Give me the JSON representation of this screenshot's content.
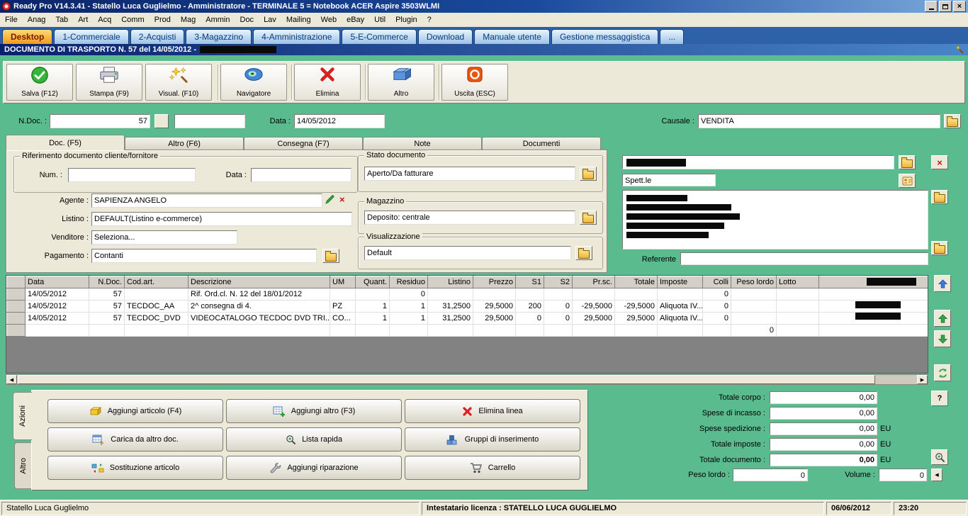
{
  "window": {
    "title": "Ready Pro V14.3.41 - Statello Luca Guglielmo - Amministratore - TERMINALE 5 = Notebook ACER Aspire 3503WLMI",
    "controls": [
      "minimize",
      "maximize",
      "close"
    ]
  },
  "menubar": {
    "items": [
      "File",
      "Anag",
      "Tab",
      "Art",
      "Acq",
      "Comm",
      "Prod",
      "Mag",
      "Ammin",
      "Doc",
      "Lav",
      "Mailing",
      "Web",
      "eBay",
      "Util",
      "Plugin",
      "?"
    ]
  },
  "tabbar": {
    "tabs": [
      "Desktop",
      "1-Commerciale",
      "2-Acquisti",
      "3-Magazzino",
      "4-Amministrazione",
      "5-E-Commerce",
      "Download",
      "Manuale utente",
      "Gestione messaggistica",
      "..."
    ],
    "active_tab": "Desktop",
    "active_color": "#ee9c1c"
  },
  "docbar": {
    "title": "DOCUMENTO DI TRASPORTO N. 57  del 14/05/2012  -",
    "icon": "magic-wand-icon"
  },
  "toolbar": {
    "buttons": [
      {
        "label": "Salva (F12)",
        "icon": "save-check-icon"
      },
      {
        "label": "Stampa (F9)",
        "icon": "printer-icon"
      },
      {
        "label": "Visual. (F10)",
        "icon": "magic-stars-icon"
      },
      {
        "label": "Navigatore",
        "icon": "navigator-eye-icon"
      },
      {
        "label": "Elimina",
        "icon": "delete-x-icon"
      },
      {
        "label": "Altro",
        "icon": "box-icon"
      },
      {
        "label": "Uscita (ESC)",
        "icon": "exit-icon"
      }
    ]
  },
  "header_fields": {
    "ndoc_label": "N.Doc. :",
    "ndoc_value": "57",
    "doc_type_value": "",
    "data_label": "Data :",
    "data_value": "14/05/2012",
    "causale_label": "Causale :",
    "causale_value": "VENDITA"
  },
  "doc_tabs": [
    "Doc. (F5)",
    "Altro (F6)",
    "Consegna (F7)",
    "Note",
    "Documenti"
  ],
  "left_panel": {
    "group_title": "Riferimento documento cliente/fornitore",
    "num_label": "Num. :",
    "num_value": "",
    "rif_data_label": "Data :",
    "rif_data_value": "",
    "agente_label": "Agente :",
    "agente_value": "SAPIENZA ANGELO",
    "listino_label": "Listino :",
    "listino_value": "DEFAULT(Listino e-commerce)",
    "venditore_label": "Venditore :",
    "venditore_value": "Seleziona...",
    "pagamento_label": "Pagamento :",
    "pagamento_value": "Contanti"
  },
  "center_panel": {
    "stato_title": "Stato documento",
    "stato_value": "Aperto/Da fatturare",
    "magazzino_title": "Magazzino",
    "magazzino_value": "Deposito: centrale",
    "visualizzazione_title": "Visualizzazione",
    "visualizzazione_value": "Default"
  },
  "customer": {
    "name_value": "",
    "spettle_value": "Spett.le",
    "referente_label": "Referente",
    "referente_value": ""
  },
  "table": {
    "columns": [
      "",
      "Data",
      "N.Doc.",
      "Cod.art.",
      "Descrizione",
      "UM",
      "Quant.",
      "Residuo",
      "Listino",
      "Prezzo",
      "S1",
      "S2",
      "Pr.sc.",
      "Totale",
      "Imposte",
      "Colli",
      "Peso lordo",
      "Lotto",
      ""
    ],
    "rows": [
      [
        "",
        "14/05/2012",
        "57",
        "",
        "Rif. Ord.cl. N. 12 del 18/01/2012",
        "",
        "",
        "0",
        "",
        "",
        "",
        "",
        "",
        "",
        "",
        "0",
        "",
        "",
        ""
      ],
      [
        "",
        "14/05/2012",
        "57",
        "TECDOC_AA",
        "2^ consegna di 4.",
        "PZ",
        "1",
        "1",
        "31,2500",
        "29,5000",
        "200",
        "0",
        "-29,5000",
        "-29,5000",
        "Aliquota IV...",
        "0",
        "",
        "",
        ""
      ],
      [
        "",
        "14/05/2012",
        "57",
        "TECDOC_DVD",
        "VIDEOCATALOGO TECDOC DVD TRI...",
        "CO...",
        "1",
        "1",
        "31,2500",
        "29,5000",
        "0",
        "0",
        "29,5000",
        "29,5000",
        "Aliquota IV...",
        "0",
        "",
        "",
        ""
      ],
      [
        "",
        "",
        "",
        "",
        "",
        "",
        "",
        "",
        "",
        "",
        "",
        "",
        "",
        "",
        "",
        "",
        "0",
        "",
        ""
      ]
    ]
  },
  "side_buttons": {
    "icons": [
      "arrow-up-blue-icon",
      "arrow-up-green-icon",
      "arrow-down-green-icon",
      "refresh-green-icon"
    ]
  },
  "actions": {
    "tabs": [
      "Azioni",
      "Altro"
    ],
    "buttons": [
      [
        {
          "label": "Aggiungi articolo (F4)",
          "icon": "yellow-box-icon"
        },
        {
          "label": "Aggiungi altro (F3)",
          "icon": "grid-plus-icon"
        },
        {
          "label": "Elimina linea",
          "icon": "red-x-icon"
        }
      ],
      [
        {
          "label": "Carica da altro doc.",
          "icon": "doc-grid-icon"
        },
        {
          "label": "Lista rapida",
          "icon": "magnifier-plus-icon"
        },
        {
          "label": "Gruppi di inserimento",
          "icon": "cubes-icon"
        }
      ],
      [
        {
          "label": "Sostituzione articolo",
          "icon": "swap-icon"
        },
        {
          "label": "Aggiungi riparazione",
          "icon": "wrench-icon"
        },
        {
          "label": "Carrello",
          "icon": "cart-icon"
        }
      ]
    ]
  },
  "totals": {
    "rows": [
      {
        "label": "Totale corpo :",
        "value": "0,00",
        "suffix": ""
      },
      {
        "label": "Spese di incasso :",
        "value": "0,00",
        "suffix": ""
      },
      {
        "label": "Spese spedizione :",
        "value": "0,00",
        "suffix": "EU"
      },
      {
        "label": "Totale imposte :",
        "value": "0,00",
        "suffix": "EU"
      },
      {
        "label": "Totale documento :",
        "value": "0,00",
        "suffix": "EU"
      }
    ],
    "peso_label": "Peso lordo :",
    "peso_value": "0",
    "volume_label": "Volume :",
    "volume_value": "0",
    "help_label": "?"
  },
  "statusbar": {
    "user": "Statello Luca Guglielmo",
    "license": "Intestatario licenza : STATELLO LUCA GUGLIELMO",
    "date": "06/06/2012",
    "time": "23:20"
  },
  "colors": {
    "workspace_green": "#5abc8e",
    "tabbar_blue": "#2d62a8",
    "active_tab_orange": "#ee9c1c",
    "titlebar_blue": "#0a246a",
    "chrome_gray": "#ece9d8"
  }
}
